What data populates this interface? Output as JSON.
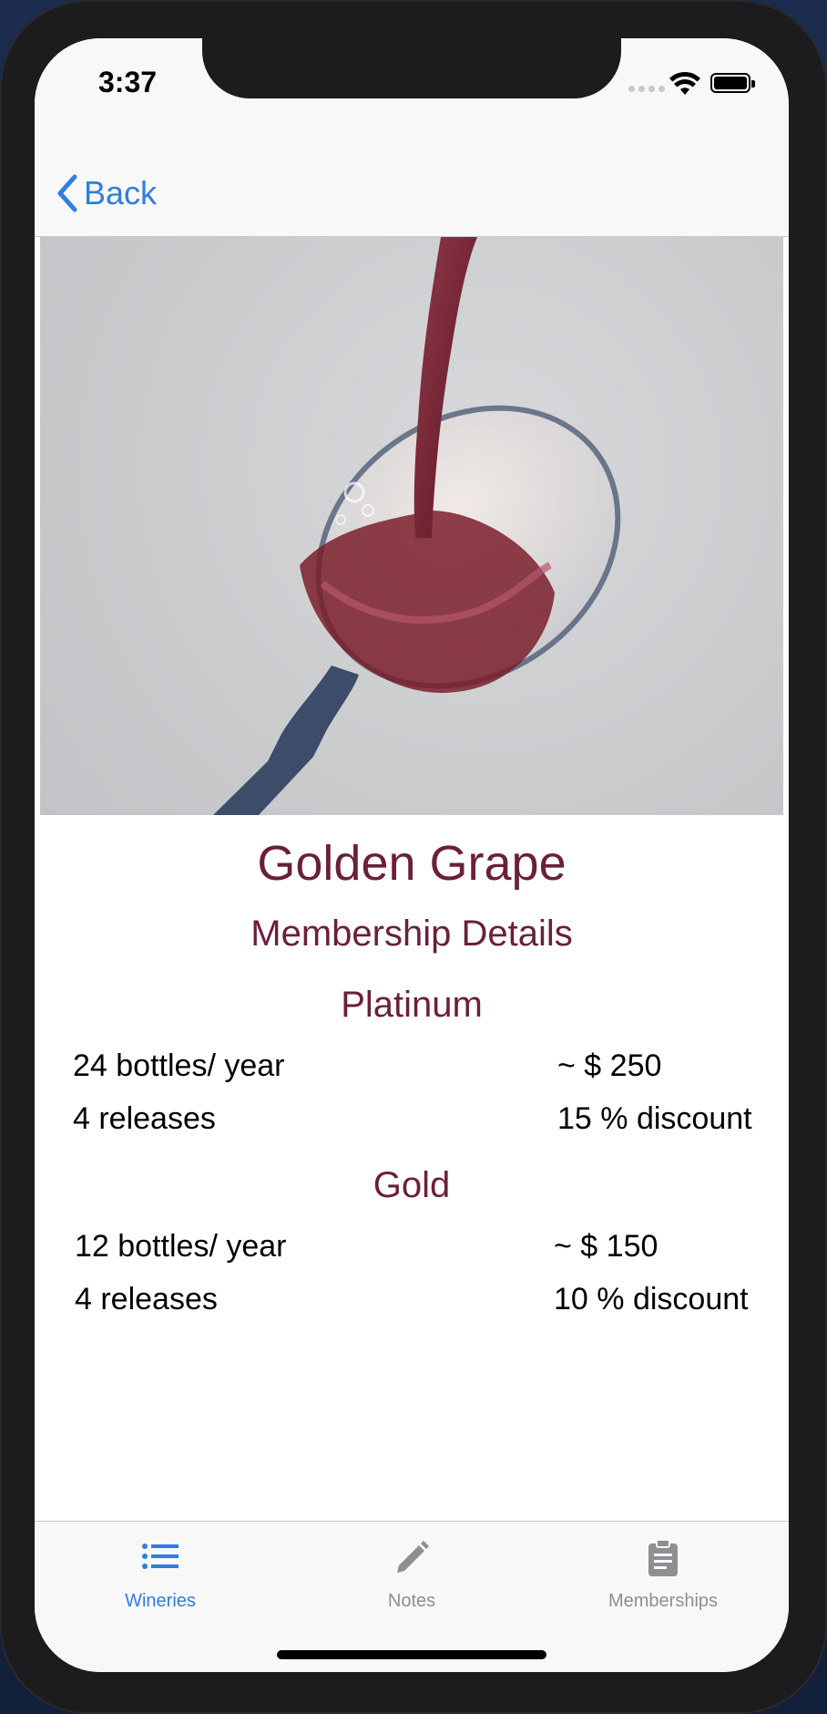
{
  "status_bar": {
    "time": "3:37"
  },
  "nav": {
    "back_label": "Back"
  },
  "winery": {
    "name": "Golden Grape",
    "section_title": "Membership Details"
  },
  "tiers": [
    {
      "name": "Platinum",
      "bottles": "24 bottles/ year",
      "price": "~ $ 250",
      "releases": "4 releases",
      "discount": "15 % discount"
    },
    {
      "name": "Gold",
      "bottles": "12 bottles/ year",
      "price": "~ $ 150",
      "releases": "4 releases",
      "discount": "10 % discount"
    }
  ],
  "tabs": [
    {
      "label": "Wineries",
      "icon": "list-icon",
      "active": true
    },
    {
      "label": "Notes",
      "icon": "pencil-icon",
      "active": false
    },
    {
      "label": "Memberships",
      "icon": "clipboard-icon",
      "active": false
    }
  ],
  "colors": {
    "accent": "#2f7ee0",
    "heading": "#6b1f3a",
    "inactive_tab": "#8e8e93",
    "wine": "#7a1f2b"
  }
}
